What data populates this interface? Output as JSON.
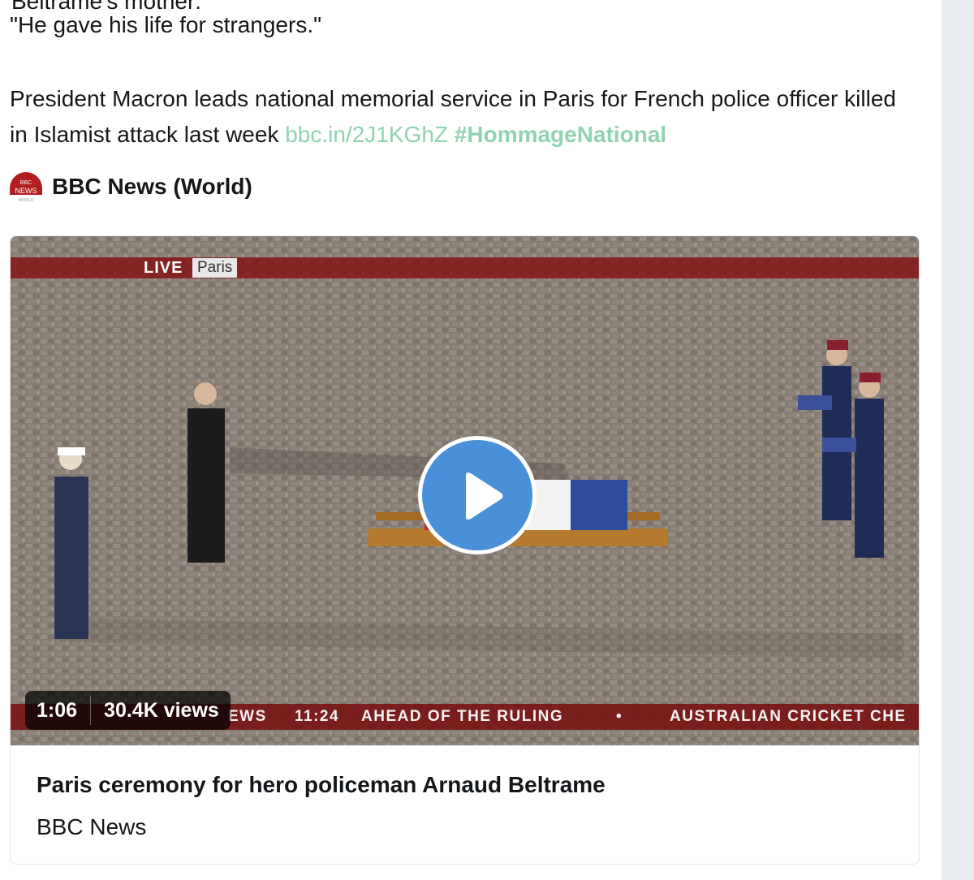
{
  "tweet": {
    "cut_line": "Beltrame's mother:",
    "quote": "\"He gave his life for strangers.\"",
    "text": "President Macron leads national memorial service in Paris for French police officer killed in Islamist attack last week",
    "link": "bbc.in/2J1KGhZ",
    "hashtag": "#HommageNational"
  },
  "source": {
    "name": "BBC News (World)",
    "logo_text_top": "BBC",
    "logo_text_mid": "NEWS",
    "logo_text_bottom": "WORLD"
  },
  "video": {
    "live_label": "LIVE",
    "location_label": "Paris",
    "ticker": {
      "brand_fragment": "EWS",
      "time": "11:24",
      "headline": "AHEAD OF THE RULING",
      "bullet": "•",
      "next_headline": "AUSTRALIAN CRICKET CHE"
    },
    "duration": "1:06",
    "views": "30.4K views"
  },
  "card": {
    "title": "Paris ceremony for hero policeman Arnaud Beltrame",
    "domain": "BBC News"
  },
  "colors": {
    "link": "#8fd3b0",
    "play_button": "#4a90d9",
    "bbc_red": "#b21e1e",
    "right_rail": "#e6ecf0"
  },
  "icons": {
    "play": "play-icon",
    "logo": "bbc-news-logo"
  }
}
